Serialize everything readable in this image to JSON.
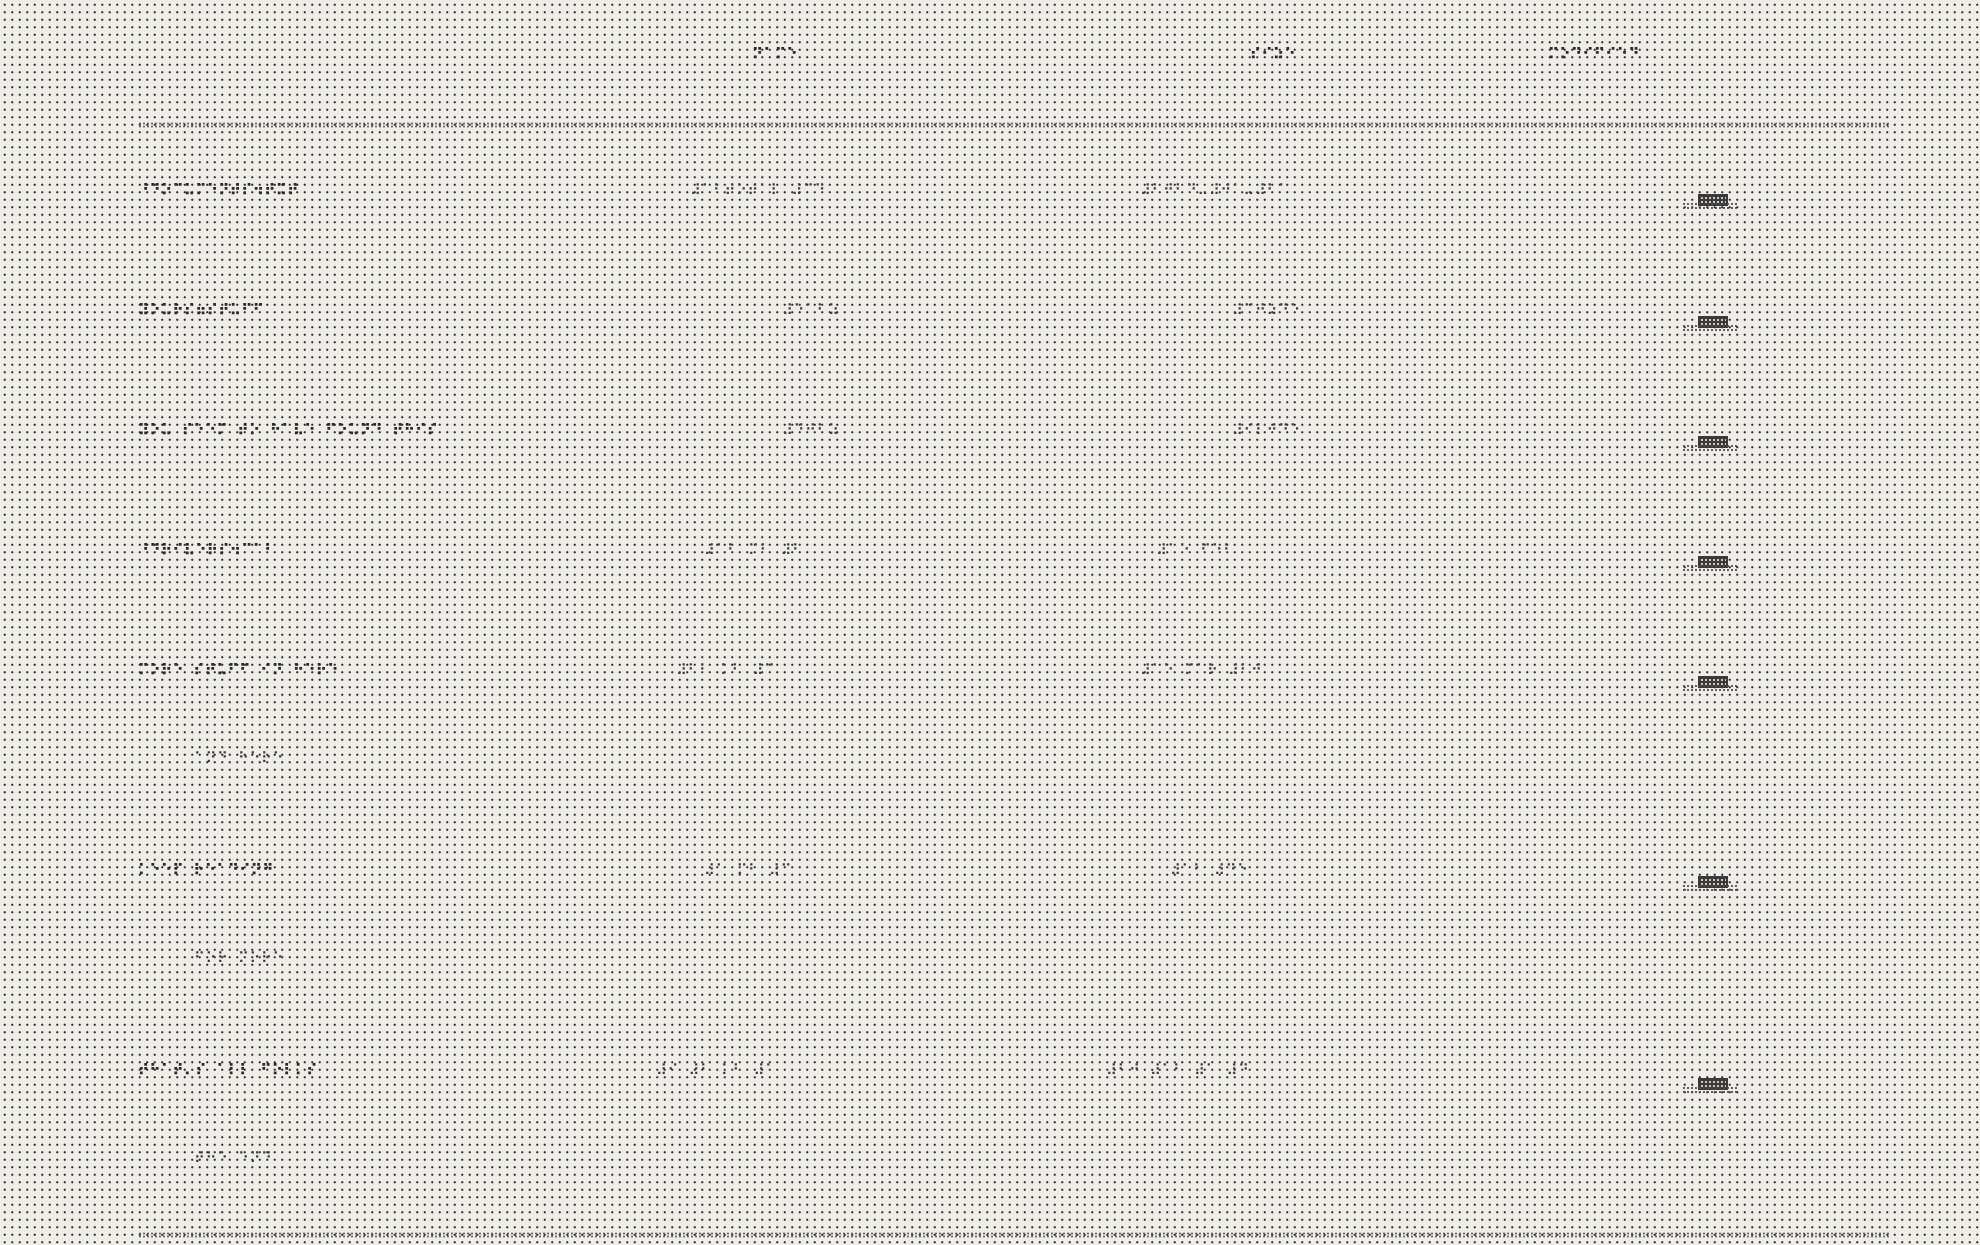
{
  "header": {
    "columns": [
      {
        "key": "col1",
        "label": "⠝⠁⠍⠑"
      },
      {
        "key": "col2",
        "label": "⠎⠊⠵⠑"
      },
      {
        "key": "col3",
        "label": "⠍⠕⠙⠊⠋⠊⠑⠙"
      }
    ]
  },
  "rows": [
    {
      "name": "⠘⠙⠕⠉⠥⠍⠑⠝⠞⠎⠲⠞⠭⠞",
      "size": "⠼⠁⠃⠞⠕⠞⠁⠇ ⠼⠉⠙",
      "date": "⠼⠃⠚⠃⠙⠤⠼⠚⠁⠤⠼⠃⠁",
      "status": "⠐⠕"
    },
    {
      "name": "⠽⠕⠥⠗⠎⠶⠎⠞⠥⠋⠋",
      "size": "⠼⠑⠁⠃⠵",
      "date": "⠼⠉⠚⠵⠙⠑",
      "status": "⠐⠕"
    },
    {
      "name": "⠽⠕⠥ ⠎⠑⠑⠍ ⠞⠕ ⠓⠁⠧⠑ ⠋⠕⠥⠝⠙ ⠞⠓⠊⠎",
      "size": "⠼⠙⠚⠃⠵",
      "date": "⠼⠊⠇⠚⠙⠑",
      "status": "⠐⠕"
    },
    {
      "name": "⠘⠙⠗⠊⠧⠑⠗⠎⠲⠉⠁⠃",
      "size": "⠼⠁⠃ ⠍⠃ ⠼⠃",
      "date": "⠼⠁⠑ ⠋⠑⠃",
      "status": "⠐⠕"
    },
    {
      "name": "⠍⠕⠗⠑ ⠎⠞⠥⠋⠋ ⠊⠝ ⠓⠑⠗⠑",
      "name2": "⠁⠝⠙ ⠓⠑⠗⠑",
      "size": "⠼⠃⠃ ⠅⠃ ⠼⠉",
      "date": "⠼⠁⠑ ⠍⠁⠗ ⠼⠃⠚",
      "status": "⠐⠕"
    },
    {
      "name": "⠅⠑⠑⠏ ⠗⠑⠁⠙⠊⠝⠛",
      "name2": "⠋⠕⠗ ⠍⠕⠗⠑",
      "size": "⠼⠁ ⠍⠃ ⠼⠉",
      "date": "⠼⠁⠃ ⠼⠙⠑",
      "status": "⠐⠕"
    },
    {
      "name": "⠞⠓⠁⠞⠄⠎ ⠁⠇⠇ ⠋⠕⠇⠅⠎",
      "name2": "⠞⠓⠑ ⠑⠝⠙",
      "size": "⠼⠊ ⠼⠃ ⠅⠃ ⠼⠁",
      "date": "⠼⠃⠚ ⠼⠁⠃ ⠼⠁ ⠼⠙",
      "status": "⠐⠕"
    }
  ]
}
